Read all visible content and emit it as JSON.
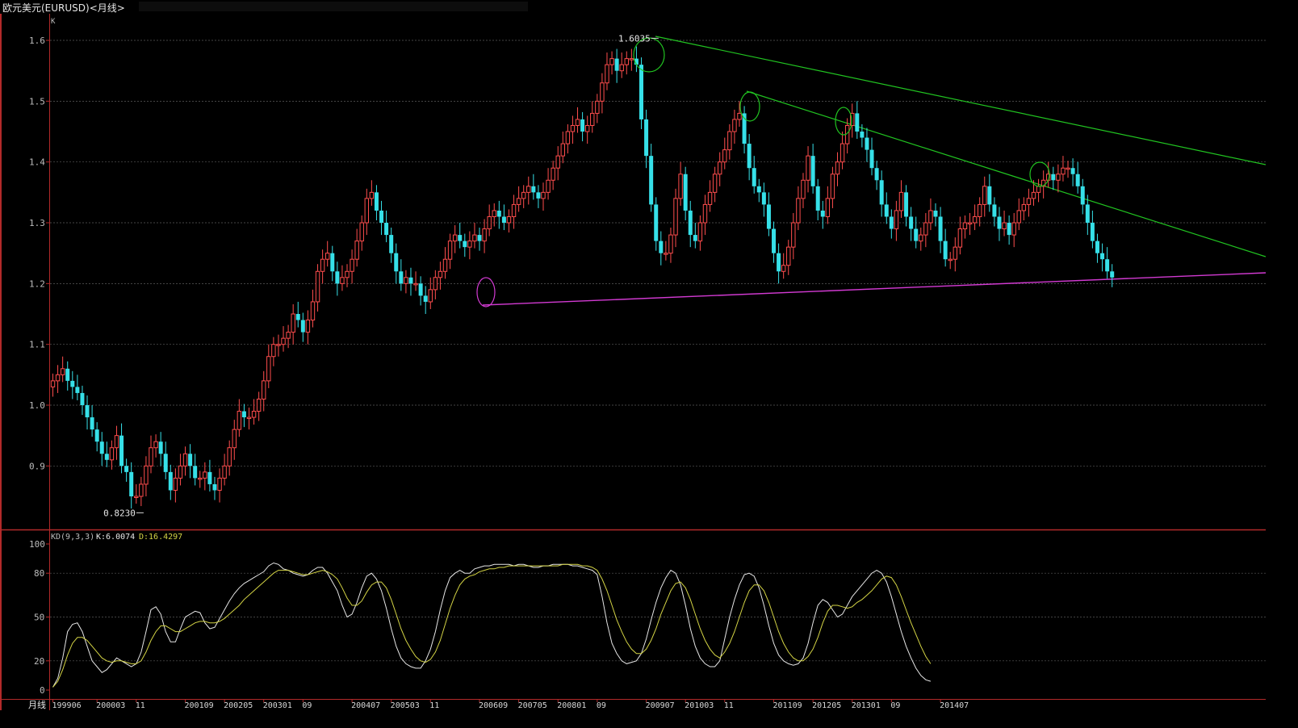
{
  "window": {
    "title": "欧元美元(EURUSD)<月线>"
  },
  "main_panel": {
    "corner_label": "K",
    "annotations": [
      {
        "text": "1.6035",
        "x_index": 124,
        "y": 1.6035,
        "side": "left"
      },
      {
        "text": "0.8230",
        "x_index": 19,
        "y": 0.823,
        "side": "left"
      }
    ]
  },
  "indicator_panel": {
    "name": "KD(9,3,3)",
    "k_label": "K:6.0074",
    "d_label": "D:16.4297"
  },
  "period_label": "月线",
  "colors": {
    "up": "#ff4d4d",
    "down": "#36e0e8",
    "k_line": "#e6e6e6",
    "d_line": "#d4d445",
    "resistance": "#21c421",
    "support": "#d23ad2",
    "grid": "#5a5a5a",
    "frame": "#b22a2a"
  },
  "chart_data": [
    {
      "type": "candlestick",
      "title": "",
      "start": "1999-06",
      "interval": "month",
      "ylim": [
        0.78,
        1.66
      ],
      "y_ticks": [
        0.9,
        1.0,
        1.1,
        1.2,
        1.3,
        1.4,
        1.5,
        1.6
      ],
      "grid": true,
      "x_tick_labels": [
        {
          "index": 0,
          "label": "199906"
        },
        {
          "index": 9,
          "label": "200003"
        },
        {
          "index": 17,
          "label": "11"
        },
        {
          "index": 27,
          "label": "200109"
        },
        {
          "index": 35,
          "label": "200205"
        },
        {
          "index": 43,
          "label": "200301"
        },
        {
          "index": 51,
          "label": "09"
        },
        {
          "index": 61,
          "label": "200407"
        },
        {
          "index": 69,
          "label": "200503"
        },
        {
          "index": 77,
          "label": "11"
        },
        {
          "index": 87,
          "label": "200609"
        },
        {
          "index": 95,
          "label": "200705"
        },
        {
          "index": 103,
          "label": "200801"
        },
        {
          "index": 111,
          "label": "09"
        },
        {
          "index": 121,
          "label": "200907"
        },
        {
          "index": 129,
          "label": "201003"
        },
        {
          "index": 137,
          "label": "11"
        },
        {
          "index": 147,
          "label": "201109"
        },
        {
          "index": 155,
          "label": "201205"
        },
        {
          "index": 163,
          "label": "201301"
        },
        {
          "index": 171,
          "label": "09"
        },
        {
          "index": 181,
          "label": "201407"
        }
      ],
      "close": [
        1.04,
        1.05,
        1.06,
        1.04,
        1.03,
        1.02,
        1.0,
        0.98,
        0.96,
        0.94,
        0.92,
        0.91,
        0.93,
        0.95,
        0.9,
        0.89,
        0.85,
        0.85,
        0.87,
        0.9,
        0.93,
        0.94,
        0.92,
        0.89,
        0.86,
        0.88,
        0.9,
        0.92,
        0.9,
        0.88,
        0.88,
        0.89,
        0.87,
        0.86,
        0.88,
        0.9,
        0.93,
        0.96,
        0.99,
        0.98,
        0.98,
        0.99,
        1.01,
        1.04,
        1.08,
        1.1,
        1.1,
        1.11,
        1.12,
        1.15,
        1.14,
        1.12,
        1.14,
        1.17,
        1.22,
        1.24,
        1.25,
        1.22,
        1.2,
        1.21,
        1.22,
        1.24,
        1.27,
        1.3,
        1.34,
        1.35,
        1.32,
        1.3,
        1.28,
        1.25,
        1.22,
        1.2,
        1.21,
        1.2,
        1.2,
        1.18,
        1.17,
        1.19,
        1.21,
        1.22,
        1.24,
        1.27,
        1.28,
        1.27,
        1.26,
        1.27,
        1.28,
        1.27,
        1.29,
        1.31,
        1.32,
        1.31,
        1.3,
        1.31,
        1.33,
        1.34,
        1.35,
        1.36,
        1.35,
        1.34,
        1.35,
        1.37,
        1.39,
        1.41,
        1.43,
        1.45,
        1.46,
        1.47,
        1.45,
        1.46,
        1.48,
        1.5,
        1.53,
        1.56,
        1.57,
        1.55,
        1.56,
        1.57,
        1.57,
        1.56,
        1.47,
        1.41,
        1.33,
        1.27,
        1.25,
        1.25,
        1.28,
        1.34,
        1.38,
        1.32,
        1.28,
        1.27,
        1.3,
        1.33,
        1.35,
        1.38,
        1.4,
        1.42,
        1.45,
        1.47,
        1.48,
        1.43,
        1.39,
        1.36,
        1.35,
        1.33,
        1.29,
        1.25,
        1.22,
        1.23,
        1.26,
        1.3,
        1.34,
        1.37,
        1.41,
        1.36,
        1.32,
        1.31,
        1.34,
        1.38,
        1.4,
        1.43,
        1.46,
        1.48,
        1.45,
        1.44,
        1.42,
        1.39,
        1.37,
        1.33,
        1.31,
        1.29,
        1.32,
        1.35,
        1.31,
        1.29,
        1.27,
        1.28,
        1.3,
        1.32,
        1.31,
        1.27,
        1.24,
        1.24,
        1.26,
        1.29,
        1.3,
        1.3,
        1.31,
        1.33,
        1.36,
        1.33,
        1.31,
        1.29,
        1.3,
        1.28,
        1.3,
        1.32,
        1.33,
        1.34,
        1.35,
        1.36,
        1.37,
        1.38,
        1.37,
        1.38,
        1.39,
        1.39,
        1.38,
        1.36,
        1.33,
        1.3,
        1.27,
        1.25,
        1.24,
        1.22,
        1.21
      ]
    },
    {
      "type": "line",
      "title": "",
      "ylim": [
        0,
        100
      ],
      "y_ticks": [
        0,
        20,
        50,
        80,
        100
      ],
      "grid": true,
      "series": [
        {
          "name": "K",
          "role": "k_line",
          "values": [
            2,
            8,
            22,
            40,
            45,
            46,
            40,
            30,
            20,
            16,
            12,
            14,
            18,
            22,
            20,
            18,
            16,
            18,
            26,
            40,
            55,
            57,
            52,
            40,
            33,
            33,
            42,
            50,
            52,
            54,
            53,
            46,
            42,
            43,
            49,
            55,
            61,
            66,
            70,
            73,
            75,
            77,
            79,
            81,
            85,
            87,
            86,
            83,
            82,
            80,
            79,
            78,
            79,
            82,
            84,
            84,
            80,
            74,
            68,
            58,
            50,
            52,
            60,
            70,
            78,
            80,
            76,
            68,
            56,
            42,
            30,
            22,
            18,
            16,
            15,
            15,
            20,
            28,
            40,
            55,
            68,
            77,
            80,
            82,
            80,
            80,
            83,
            84,
            85,
            85,
            86,
            86,
            86,
            86,
            85,
            86,
            86,
            85,
            84,
            84,
            85,
            85,
            86,
            86,
            86,
            86,
            85,
            85,
            84,
            83,
            82,
            79,
            64,
            46,
            32,
            25,
            20,
            18,
            19,
            20,
            25,
            35,
            48,
            60,
            70,
            77,
            82,
            80,
            72,
            58,
            42,
            30,
            22,
            18,
            16,
            16,
            20,
            35,
            50,
            62,
            72,
            79,
            80,
            78,
            70,
            58,
            44,
            32,
            24,
            20,
            18,
            17,
            18,
            22,
            32,
            46,
            58,
            62,
            60,
            55,
            50,
            52,
            58,
            64,
            68,
            72,
            76,
            80,
            82,
            80,
            74,
            64,
            52,
            40,
            30,
            22,
            15,
            10,
            7,
            6
          ]
        },
        {
          "name": "D",
          "role": "d_line",
          "values": [
            2,
            6,
            14,
            24,
            32,
            36,
            36,
            34,
            30,
            26,
            22,
            20,
            19,
            20,
            20,
            19,
            18,
            18,
            20,
            26,
            34,
            40,
            44,
            44,
            42,
            40,
            40,
            42,
            44,
            46,
            47,
            47,
            46,
            46,
            47,
            49,
            52,
            55,
            58,
            62,
            65,
            68,
            71,
            74,
            77,
            80,
            82,
            82,
            82,
            81,
            80,
            79,
            79,
            80,
            81,
            82,
            81,
            79,
            76,
            70,
            63,
            58,
            58,
            61,
            67,
            72,
            74,
            74,
            70,
            62,
            52,
            42,
            34,
            28,
            23,
            20,
            19,
            21,
            26,
            34,
            45,
            56,
            65,
            72,
            76,
            78,
            79,
            81,
            82,
            83,
            83,
            84,
            84,
            85,
            85,
            85,
            85,
            85,
            85,
            85,
            85,
            85,
            85,
            85,
            86,
            86,
            86,
            86,
            85,
            85,
            84,
            82,
            76,
            68,
            58,
            48,
            40,
            33,
            28,
            25,
            25,
            28,
            34,
            42,
            52,
            60,
            68,
            73,
            74,
            70,
            62,
            52,
            42,
            34,
            28,
            24,
            22,
            26,
            32,
            40,
            50,
            60,
            68,
            72,
            72,
            68,
            60,
            50,
            40,
            32,
            26,
            22,
            20,
            20,
            23,
            28,
            36,
            46,
            54,
            58,
            58,
            57,
            56,
            57,
            60,
            62,
            65,
            68,
            72,
            76,
            78,
            77,
            72,
            64,
            55,
            46,
            38,
            30,
            23,
            18
          ]
        }
      ]
    }
  ]
}
